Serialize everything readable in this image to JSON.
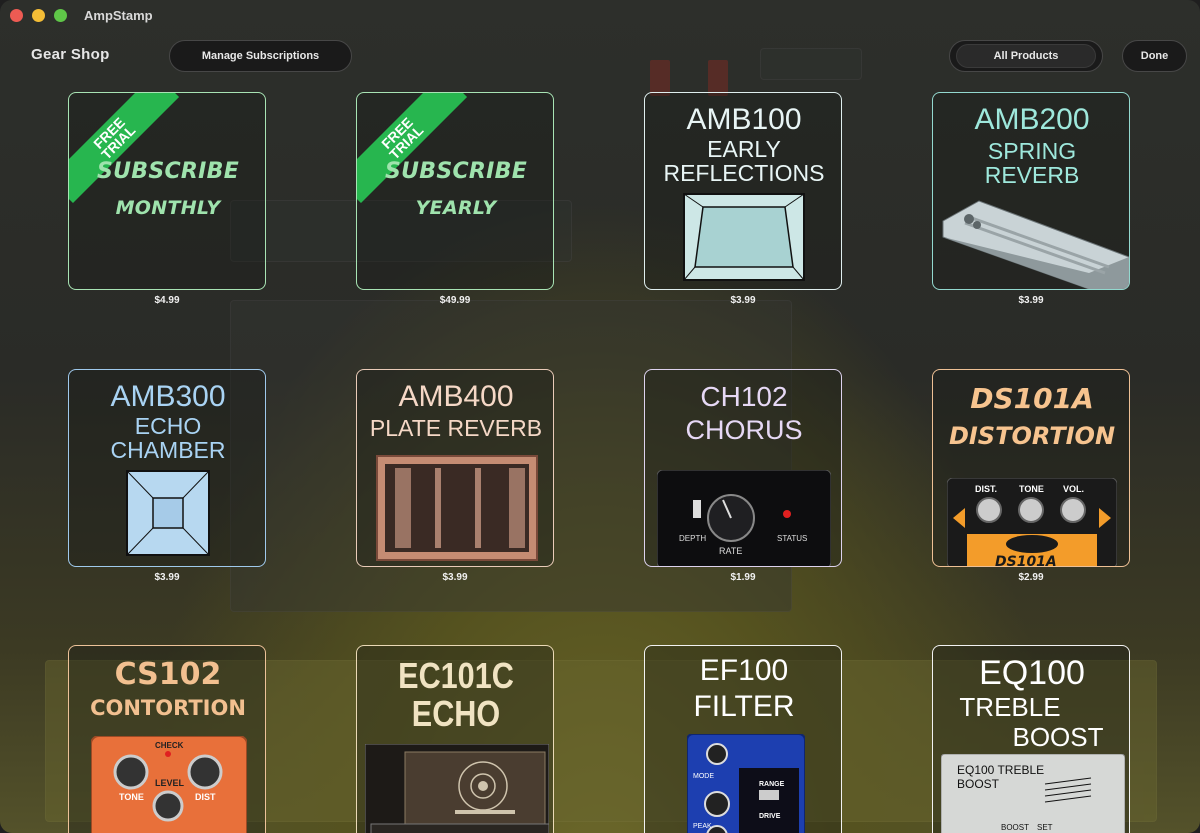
{
  "window": {
    "title": "AmpStamp"
  },
  "header": {
    "shop_title": "Gear Shop",
    "manage_label": "Manage Subscriptions",
    "filter_label": "All Products",
    "done_label": "Done"
  },
  "products": [
    {
      "ribbon": "FREE\nTRIAL",
      "line1": "SUBSCRIBE",
      "line2": "MONTHLY",
      "price": "$4.99",
      "color": "#9fe3ad"
    },
    {
      "ribbon": "FREE\nTRIAL",
      "line1": "SUBSCRIBE",
      "line2": "YEARLY",
      "price": "$49.99",
      "color": "#9fe3ad"
    },
    {
      "code": "AMB100",
      "name1": "EARLY",
      "name2": "REFLECTIONS",
      "price": "$3.99",
      "color": "#e8f5f5"
    },
    {
      "code": "AMB200",
      "name1": "SPRING",
      "name2": "REVERB",
      "price": "$3.99",
      "color": "#9ee8dc"
    },
    {
      "code": "AMB300",
      "name1": "ECHO",
      "name2": "CHAMBER",
      "price": "$3.99",
      "color": "#a9d3f3"
    },
    {
      "code": "AMB400",
      "name1": "PLATE REVERB",
      "price": "$3.99",
      "color": "#f5d8c6"
    },
    {
      "code": "CH102",
      "name1": "CHORUS",
      "price": "$1.99",
      "color": "#e6d8f5",
      "pedal_labels": [
        "DEPTH",
        "RATE",
        "STATUS"
      ]
    },
    {
      "code": "DS101A",
      "name1": "DISTORTION",
      "price": "$2.99",
      "color": "#f7c48f",
      "pedal_labels": [
        "DIST.",
        "TONE",
        "VOL.",
        "DS101A"
      ]
    },
    {
      "code": "CS102",
      "name1": "CONTORTION",
      "color": "#f2c090",
      "pedal_labels": [
        "CHECK",
        "LEVEL",
        "TONE",
        "DIST"
      ]
    },
    {
      "code": "EC101C",
      "name1": "ECHO",
      "color": "#f0e3c2"
    },
    {
      "code": "EF100",
      "name1": "FILTER",
      "color": "#ffffff",
      "pedal_labels": [
        "MODE",
        "RANGE",
        "DRIVE",
        "PEAK"
      ]
    },
    {
      "code": "EQ100",
      "name1": "TREBLE",
      "name2": "BOOST",
      "color": "#ffffff",
      "pedal_labels": [
        "EQ100 TREBLE",
        "BOOST",
        "BOOST",
        "SET"
      ]
    }
  ]
}
